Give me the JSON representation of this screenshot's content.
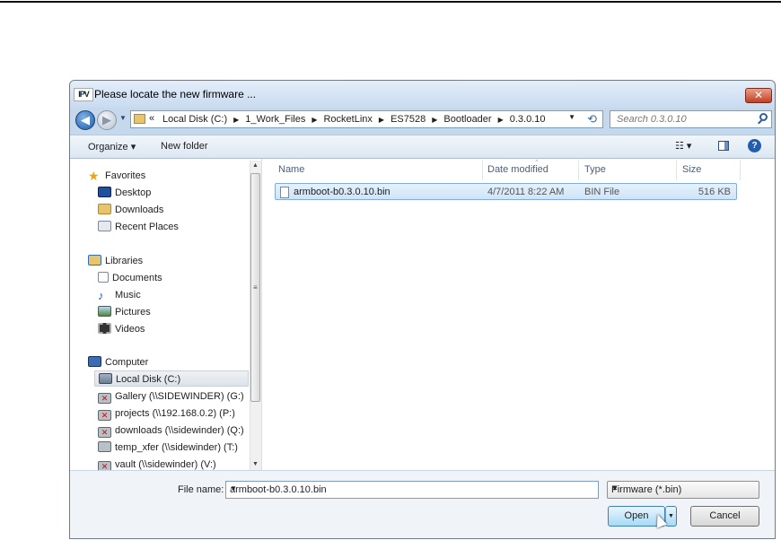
{
  "window": {
    "app_icon_text": "IPV",
    "title": "Please locate the new firmware ...",
    "close_glyph": "✕"
  },
  "navigation": {
    "back_glyph": "◀",
    "forward_glyph": "▶",
    "path_prefix": "«",
    "breadcrumbs": [
      "Local Disk (C:)",
      "1_Work_Files",
      "RocketLinx",
      "ES7528",
      "Bootloader",
      "0.3.0.10"
    ],
    "separator": "▶",
    "search_placeholder": "Search 0.3.0.10"
  },
  "toolbar": {
    "organize_label": "Organize ▾",
    "new_folder_label": "New folder",
    "views_glyph": "☷ ▾",
    "help_glyph": "?"
  },
  "sidebar": {
    "favorites": {
      "label": "Favorites",
      "items": [
        "Desktop",
        "Downloads",
        "Recent Places"
      ]
    },
    "libraries": {
      "label": "Libraries",
      "items": [
        "Documents",
        "Music",
        "Pictures",
        "Videos"
      ]
    },
    "computer": {
      "label": "Computer",
      "items": [
        "Local Disk (C:)",
        "Gallery (\\\\SIDEWINDER) (G:)",
        "projects (\\\\192.168.0.2) (P:)",
        "downloads (\\\\sidewinder) (Q:)",
        "temp_xfer (\\\\sidewinder) (T:)",
        "vault (\\\\sidewinder) (V:)"
      ]
    },
    "selected_item": "Local Disk (C:)"
  },
  "file_list": {
    "columns": [
      "Name",
      "Date modified",
      "Type",
      "Size"
    ],
    "rows": [
      {
        "name": "armboot-b0.3.0.10.bin",
        "date": "4/7/2011 8:22 AM",
        "type": "BIN File",
        "size": "516 KB"
      }
    ]
  },
  "footer": {
    "file_name_label": "File name:",
    "file_name_value": "armboot-b0.3.0.10.bin",
    "filter_value": "Firmware (*.bin)",
    "open_label": "Open",
    "cancel_label": "Cancel"
  },
  "colors": {
    "accent": "#1d5aa8",
    "selection": "#cfe4f8",
    "close_red": "#c33f22"
  }
}
